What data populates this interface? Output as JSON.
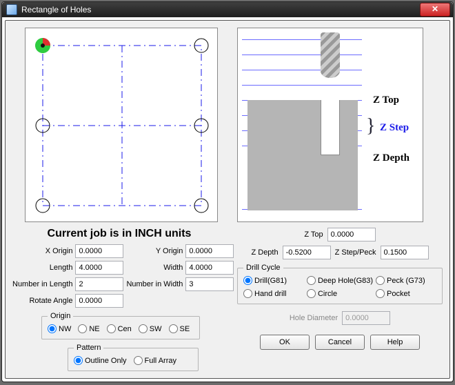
{
  "window": {
    "title": "Rectangle of Holes",
    "close_label": "✕"
  },
  "status": "Current job is in INCH units",
  "left_form": {
    "x_origin_label": "X Origin",
    "x_origin": "0.0000",
    "y_origin_label": "Y Origin",
    "y_origin": "0.0000",
    "length_label": "Length",
    "length": "4.0000",
    "width_label": "Width",
    "width": "4.0000",
    "num_len_label": "Number in Length",
    "num_len": "2",
    "num_wid_label": "Number in Width",
    "num_wid": "3",
    "rotate_label": "Rotate Angle",
    "rotate": "0.0000"
  },
  "origin": {
    "legend": "Origin",
    "options": [
      "NW",
      "NE",
      "Cen",
      "SW",
      "SE"
    ],
    "selected": "NW"
  },
  "pattern": {
    "legend": "Pattern",
    "options": [
      "Outline Only",
      "Full Array"
    ],
    "selected": "Outline Only"
  },
  "depth": {
    "z_top_annot": "Z Top",
    "z_step_annot": "Z Step",
    "z_depth_annot": "Z Depth",
    "z_top_label": "Z Top",
    "z_top": "0.0000",
    "z_depth_label": "Z Depth",
    "z_depth": "-0.5200",
    "z_step_label": "Z Step/Peck",
    "z_step": "0.1500"
  },
  "drill_cycle": {
    "legend": "Drill Cycle",
    "options": [
      "Drill(G81)",
      "Deep Hole(G83)",
      "Peck (G73)",
      "Hand drill",
      "Circle",
      "Pocket"
    ],
    "selected": "Drill(G81)"
  },
  "hole_diameter": {
    "label": "Hole Diameter",
    "value": "0.0000",
    "enabled": false
  },
  "buttons": {
    "ok": "OK",
    "cancel": "Cancel",
    "help": "Help"
  }
}
